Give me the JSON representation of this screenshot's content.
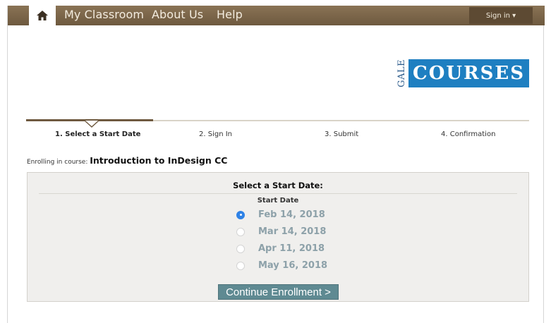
{
  "nav": {
    "items": [
      "My Classroom",
      "About Us",
      "Help"
    ],
    "signin_label": "Sign in ▾"
  },
  "logo": {
    "gale": "GALE",
    "courses": "COURSES"
  },
  "steps": [
    "1. Select a Start Date",
    "2. Sign In",
    "3. Submit",
    "4. Confirmation"
  ],
  "enroll": {
    "prefix": "Enrolling in course:",
    "course": "Introduction to InDesign CC"
  },
  "panel": {
    "title": "Select a Start Date:",
    "subtitle": "Start Date",
    "dates": [
      "Feb 14, 2018",
      "Mar 14, 2018",
      "Apr 11, 2018",
      "May 16, 2018"
    ],
    "selected": "Feb 14, 2018",
    "continue_label": "Continue Enrollment >"
  },
  "colors": {
    "navbar": "#7a6449",
    "accent_blue": "#1e7fc1",
    "button": "#5f8a92",
    "radio_selected": "#2f82e6"
  }
}
